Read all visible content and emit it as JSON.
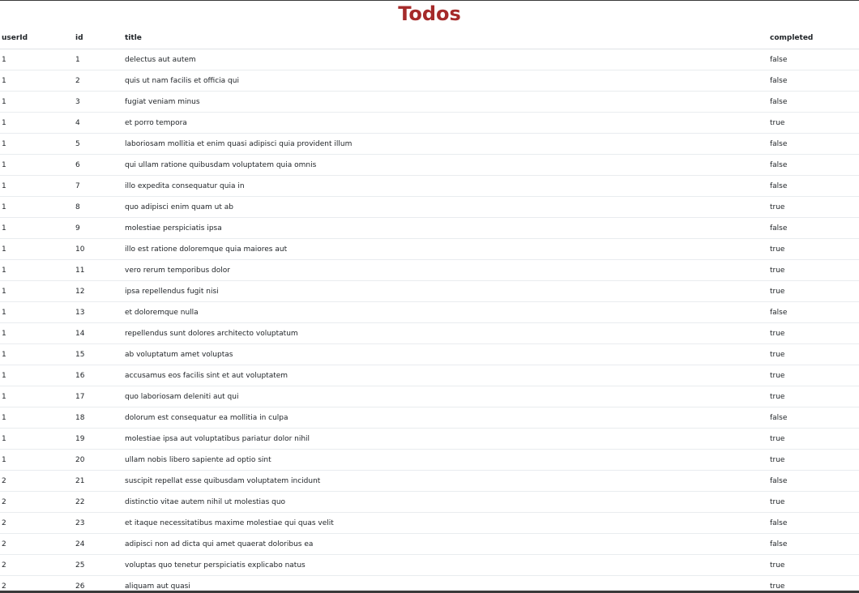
{
  "page": {
    "title": "Todos"
  },
  "table": {
    "headers": {
      "userId": "userId",
      "id": "id",
      "title": "title",
      "completed": "completed"
    },
    "rows": [
      {
        "userId": "1",
        "id": "1",
        "title": "delectus aut autem",
        "completed": "false"
      },
      {
        "userId": "1",
        "id": "2",
        "title": "quis ut nam facilis et officia qui",
        "completed": "false"
      },
      {
        "userId": "1",
        "id": "3",
        "title": "fugiat veniam minus",
        "completed": "false"
      },
      {
        "userId": "1",
        "id": "4",
        "title": "et porro tempora",
        "completed": "true"
      },
      {
        "userId": "1",
        "id": "5",
        "title": "laboriosam mollitia et enim quasi adipisci quia provident illum",
        "completed": "false"
      },
      {
        "userId": "1",
        "id": "6",
        "title": "qui ullam ratione quibusdam voluptatem quia omnis",
        "completed": "false"
      },
      {
        "userId": "1",
        "id": "7",
        "title": "illo expedita consequatur quia in",
        "completed": "false"
      },
      {
        "userId": "1",
        "id": "8",
        "title": "quo adipisci enim quam ut ab",
        "completed": "true"
      },
      {
        "userId": "1",
        "id": "9",
        "title": "molestiae perspiciatis ipsa",
        "completed": "false"
      },
      {
        "userId": "1",
        "id": "10",
        "title": "illo est ratione doloremque quia maiores aut",
        "completed": "true"
      },
      {
        "userId": "1",
        "id": "11",
        "title": "vero rerum temporibus dolor",
        "completed": "true"
      },
      {
        "userId": "1",
        "id": "12",
        "title": "ipsa repellendus fugit nisi",
        "completed": "true"
      },
      {
        "userId": "1",
        "id": "13",
        "title": "et doloremque nulla",
        "completed": "false"
      },
      {
        "userId": "1",
        "id": "14",
        "title": "repellendus sunt dolores architecto voluptatum",
        "completed": "true"
      },
      {
        "userId": "1",
        "id": "15",
        "title": "ab voluptatum amet voluptas",
        "completed": "true"
      },
      {
        "userId": "1",
        "id": "16",
        "title": "accusamus eos facilis sint et aut voluptatem",
        "completed": "true"
      },
      {
        "userId": "1",
        "id": "17",
        "title": "quo laboriosam deleniti aut qui",
        "completed": "true"
      },
      {
        "userId": "1",
        "id": "18",
        "title": "dolorum est consequatur ea mollitia in culpa",
        "completed": "false"
      },
      {
        "userId": "1",
        "id": "19",
        "title": "molestiae ipsa aut voluptatibus pariatur dolor nihil",
        "completed": "true"
      },
      {
        "userId": "1",
        "id": "20",
        "title": "ullam nobis libero sapiente ad optio sint",
        "completed": "true"
      },
      {
        "userId": "2",
        "id": "21",
        "title": "suscipit repellat esse quibusdam voluptatem incidunt",
        "completed": "false"
      },
      {
        "userId": "2",
        "id": "22",
        "title": "distinctio vitae autem nihil ut molestias quo",
        "completed": "true"
      },
      {
        "userId": "2",
        "id": "23",
        "title": "et itaque necessitatibus maxime molestiae qui quas velit",
        "completed": "false"
      },
      {
        "userId": "2",
        "id": "24",
        "title": "adipisci non ad dicta qui amet quaerat doloribus ea",
        "completed": "false"
      },
      {
        "userId": "2",
        "id": "25",
        "title": "voluptas quo tenetur perspiciatis explicabo natus",
        "completed": "true"
      },
      {
        "userId": "2",
        "id": "26",
        "title": "aliquam aut quasi",
        "completed": "true"
      }
    ]
  },
  "colors": {
    "title": "#a52a2a",
    "text": "#212529",
    "row_border": "#e9ecef"
  }
}
